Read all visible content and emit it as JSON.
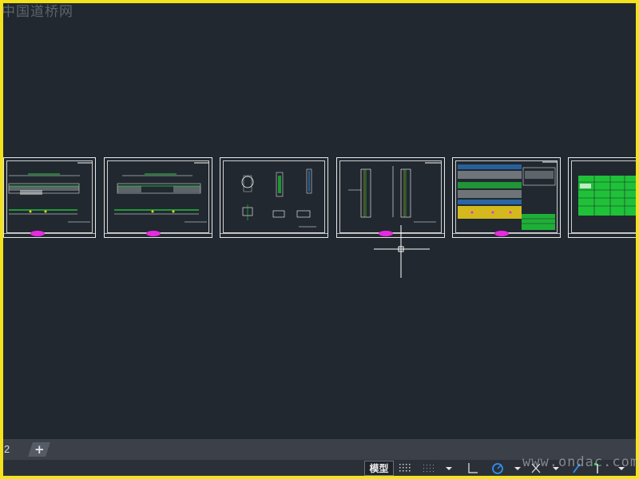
{
  "watermark_top": "中国道桥网",
  "watermark_bottom": "www.ondac.com",
  "layout_tab_number": "2",
  "add_tab_symbol": "+",
  "status": {
    "model_label": "模型"
  },
  "sheets": [
    {
      "name": "sheet-1",
      "content": "road cross-section drawing"
    },
    {
      "name": "sheet-2",
      "content": "road cross-section drawing"
    },
    {
      "name": "sheet-3",
      "content": "detail drawings"
    },
    {
      "name": "sheet-4",
      "content": "pile/column elevation drawings"
    },
    {
      "name": "sheet-5",
      "content": "layered section with colored bands"
    },
    {
      "name": "sheet-6",
      "content": "quantity table (green)"
    }
  ],
  "colors": {
    "window_border": "#f4e21a",
    "model_space_background": "#212830",
    "stamp": "#e82adf",
    "table_green": "#1fdc3a",
    "accent_blue": "#2f8ff0"
  },
  "icons": [
    "crosshair-cursor",
    "grid-icon",
    "snap-icon",
    "ortho-icon",
    "polar-icon",
    "osnap-icon",
    "annotation-scale-icon"
  ]
}
